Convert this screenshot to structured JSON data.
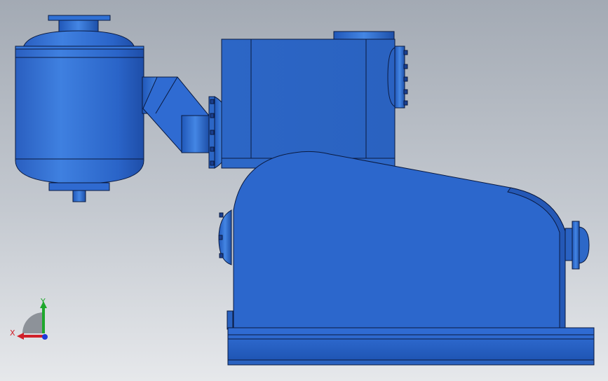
{
  "viewport": {
    "background_top": "#a3aab4",
    "background_bottom": "#e6e8eb"
  },
  "model": {
    "color_base": "#2d68c8",
    "color_light": "#4a8be6",
    "color_dark": "#123f91",
    "edge_color": "#0a1a40",
    "components": [
      "separator-tank",
      "elbow-pipe",
      "inlet-chamber",
      "pump-casing",
      "discharge-flange",
      "base-skid"
    ]
  },
  "triad": {
    "x_label": "X",
    "y_label": "Y",
    "x_color": "#d0202a",
    "y_color": "#1ea82c",
    "z_color": "#1d3ad8"
  }
}
